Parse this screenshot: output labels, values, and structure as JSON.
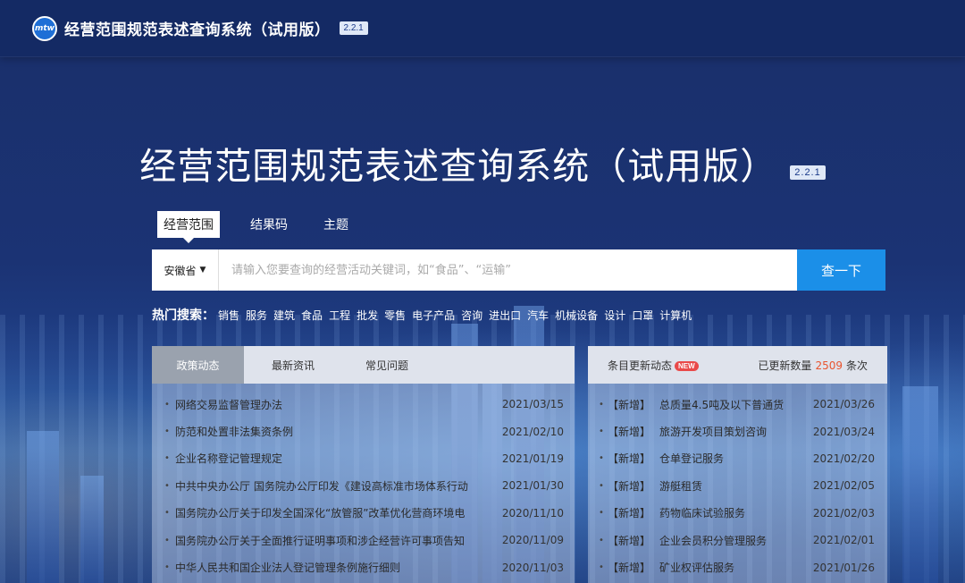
{
  "header": {
    "logo_text": "mtw",
    "title": "经营范围规范表述查询系统（试用版）",
    "version": "2.2.1"
  },
  "hero": {
    "title": "经营范围规范表述查询系统（试用版）",
    "version": "2.2.1"
  },
  "search": {
    "tabs": [
      {
        "label": "经营范围",
        "active": true
      },
      {
        "label": "结果码",
        "active": false
      },
      {
        "label": "主题",
        "active": false
      }
    ],
    "province": "安徽省",
    "placeholder": "请输入您要查询的经营活动关键词，如“食品”、“运输”",
    "button": "查一下"
  },
  "hot_search": {
    "label": "热门搜索：",
    "items": [
      "销售",
      "服务",
      "建筑",
      "食品",
      "工程",
      "批发",
      "零售",
      "电子产品",
      "咨询",
      "进出口",
      "汽车",
      "机械设备",
      "设计",
      "口罩",
      "计算机"
    ]
  },
  "left_panel": {
    "tabs": [
      {
        "label": "政策动态",
        "active": true
      },
      {
        "label": "最新资讯",
        "active": false
      },
      {
        "label": "常见问题",
        "active": false
      }
    ],
    "items": [
      {
        "title": "网络交易监督管理办法",
        "date": "2021/03/15"
      },
      {
        "title": "防范和处置非法集资条例",
        "date": "2021/02/10"
      },
      {
        "title": "企业名称登记管理规定",
        "date": "2021/01/19"
      },
      {
        "title": "中共中央办公厅 国务院办公厅印发《建设高标准市场体系行动",
        "date": "2021/01/30"
      },
      {
        "title": "国务院办公厅关于印发全国深化“放管服”改革优化营商环境电",
        "date": "2020/11/10"
      },
      {
        "title": "国务院办公厅关于全面推行证明事项和涉企经营许可事项告知",
        "date": "2020/11/09"
      },
      {
        "title": "中华人民共和国企业法人登记管理条例施行细则",
        "date": "2020/11/03"
      }
    ]
  },
  "right_panel": {
    "title": "条目更新动态",
    "new_badge": "NEW",
    "count_label": "已更新数量",
    "count": "2509",
    "count_unit": "条次",
    "items": [
      {
        "tag": "【新增】",
        "title": "总质量4.5吨及以下普通货",
        "date": "2021/03/26"
      },
      {
        "tag": "【新增】",
        "title": "旅游开发项目策划咨询",
        "date": "2021/03/24"
      },
      {
        "tag": "【新增】",
        "title": "仓单登记服务",
        "date": "2021/02/20"
      },
      {
        "tag": "【新增】",
        "title": "游艇租赁",
        "date": "2021/02/05"
      },
      {
        "tag": "【新增】",
        "title": "药物临床试验服务",
        "date": "2021/02/03"
      },
      {
        "tag": "【新增】",
        "title": "企业会员积分管理服务",
        "date": "2021/02/01"
      },
      {
        "tag": "【新增】",
        "title": "矿业权评估服务",
        "date": "2021/01/26"
      }
    ]
  }
}
